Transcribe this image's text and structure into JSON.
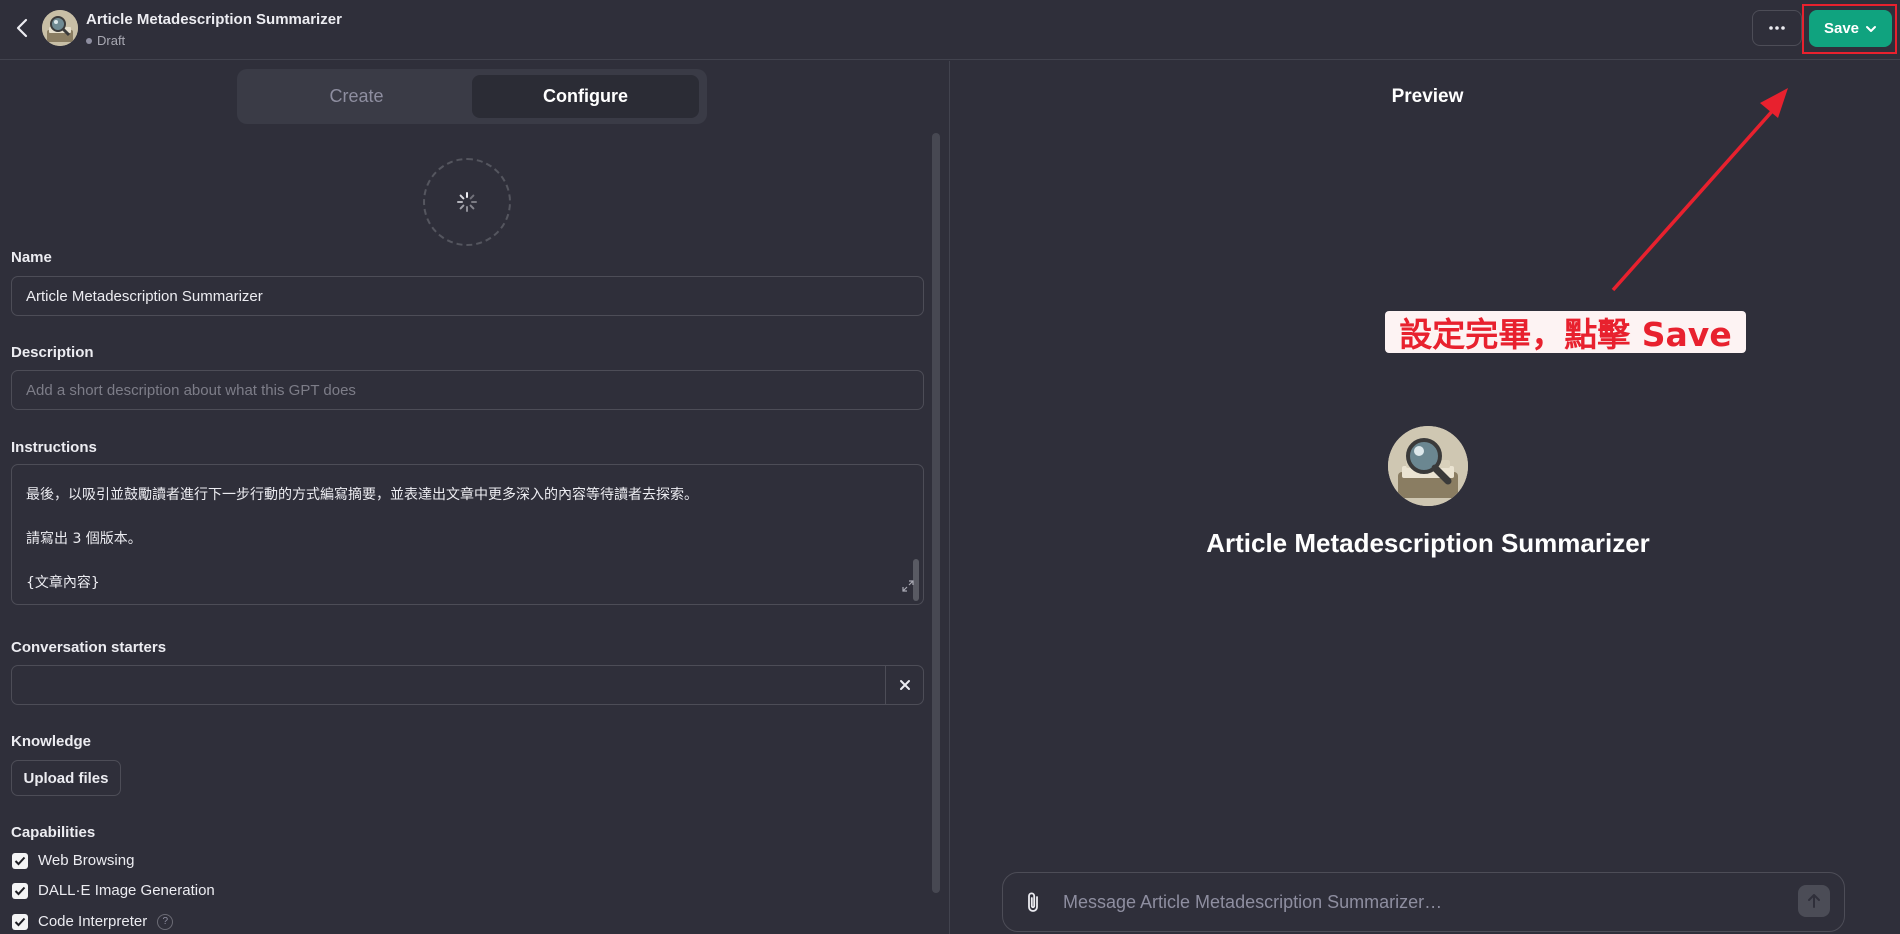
{
  "header": {
    "title": "Article Metadescription Summarizer",
    "status": "Draft",
    "save_label": "Save"
  },
  "tabs": [
    {
      "label": "Create"
    },
    {
      "label": "Configure"
    }
  ],
  "form": {
    "name_label": "Name",
    "name_value": "Article Metadescription Summarizer",
    "description_label": "Description",
    "description_placeholder": "Add a short description about what this GPT does",
    "instructions_label": "Instructions",
    "instructions_lines": [
      "最後，以吸引並鼓勵讀者進行下一步行動的方式編寫摘要，並表達出文章中更多深入的內容等待讀者去探索。",
      "請寫出 3 個版本。",
      "{文章內容}"
    ],
    "starters_label": "Conversation starters",
    "knowledge_label": "Knowledge",
    "upload_label": "Upload files",
    "capabilities_label": "Capabilities",
    "capabilities": [
      {
        "label": "Web Browsing",
        "checked": true
      },
      {
        "label": "DALL·E Image Generation",
        "checked": true
      },
      {
        "label": "Code Interpreter",
        "checked": true
      }
    ],
    "help_glyph": "?"
  },
  "preview": {
    "title": "Preview",
    "gpt_name": "Article Metadescription Summarizer",
    "composer_placeholder": "Message Article Metadescription Summarizer…"
  },
  "annotation": {
    "text": "設定完畢，點擊 Save",
    "color": "#e8212e"
  },
  "colors": {
    "accent": "#10a37f",
    "background": "#2f2f3a"
  }
}
